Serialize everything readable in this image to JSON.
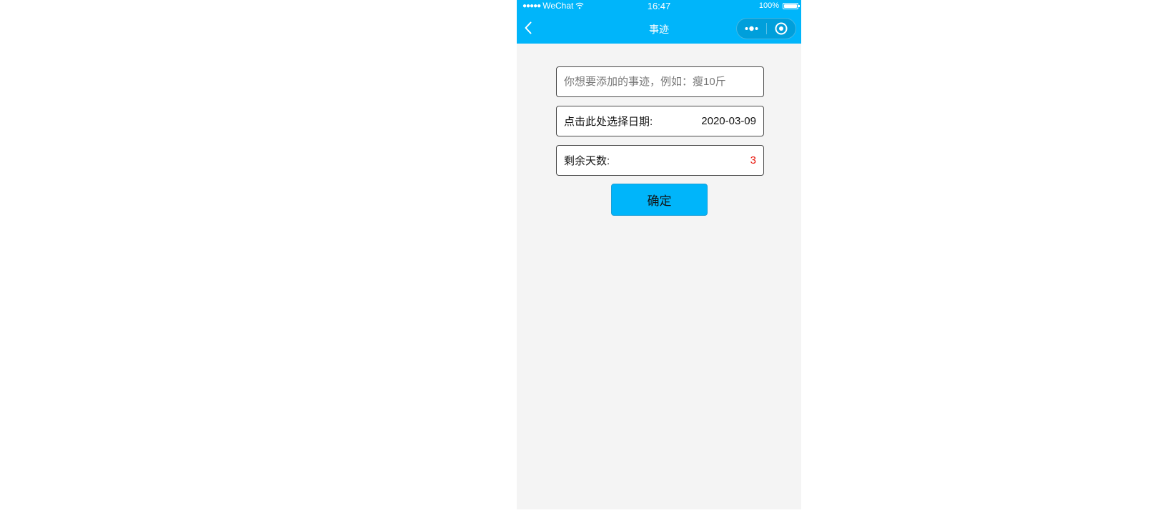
{
  "status_bar": {
    "signal_dots": "●●●●●",
    "carrier": "WeChat",
    "wifi_icon": "wifi-icon",
    "time": "16:47",
    "battery_percent": "100%",
    "battery_level": 1.0
  },
  "navbar": {
    "back_icon": "chevron-left-icon",
    "title": "事迹",
    "capsule": {
      "more_icon": "more-dots-icon",
      "close_icon": "target-circle-icon"
    }
  },
  "form": {
    "event_input": {
      "placeholder": "你想要添加的事迹，例如：瘦10斤",
      "value": ""
    },
    "date_picker": {
      "label": "点击此处选择日期:",
      "value": "2020-03-09"
    },
    "remaining_days": {
      "label": "剩余天数:",
      "value": "3"
    },
    "confirm_label": "确定"
  },
  "colors": {
    "header_bg": "#00b5fa",
    "page_bg": "#f4f4f4",
    "accent_red": "#e8140b",
    "button_bg": "#00b5fa"
  }
}
